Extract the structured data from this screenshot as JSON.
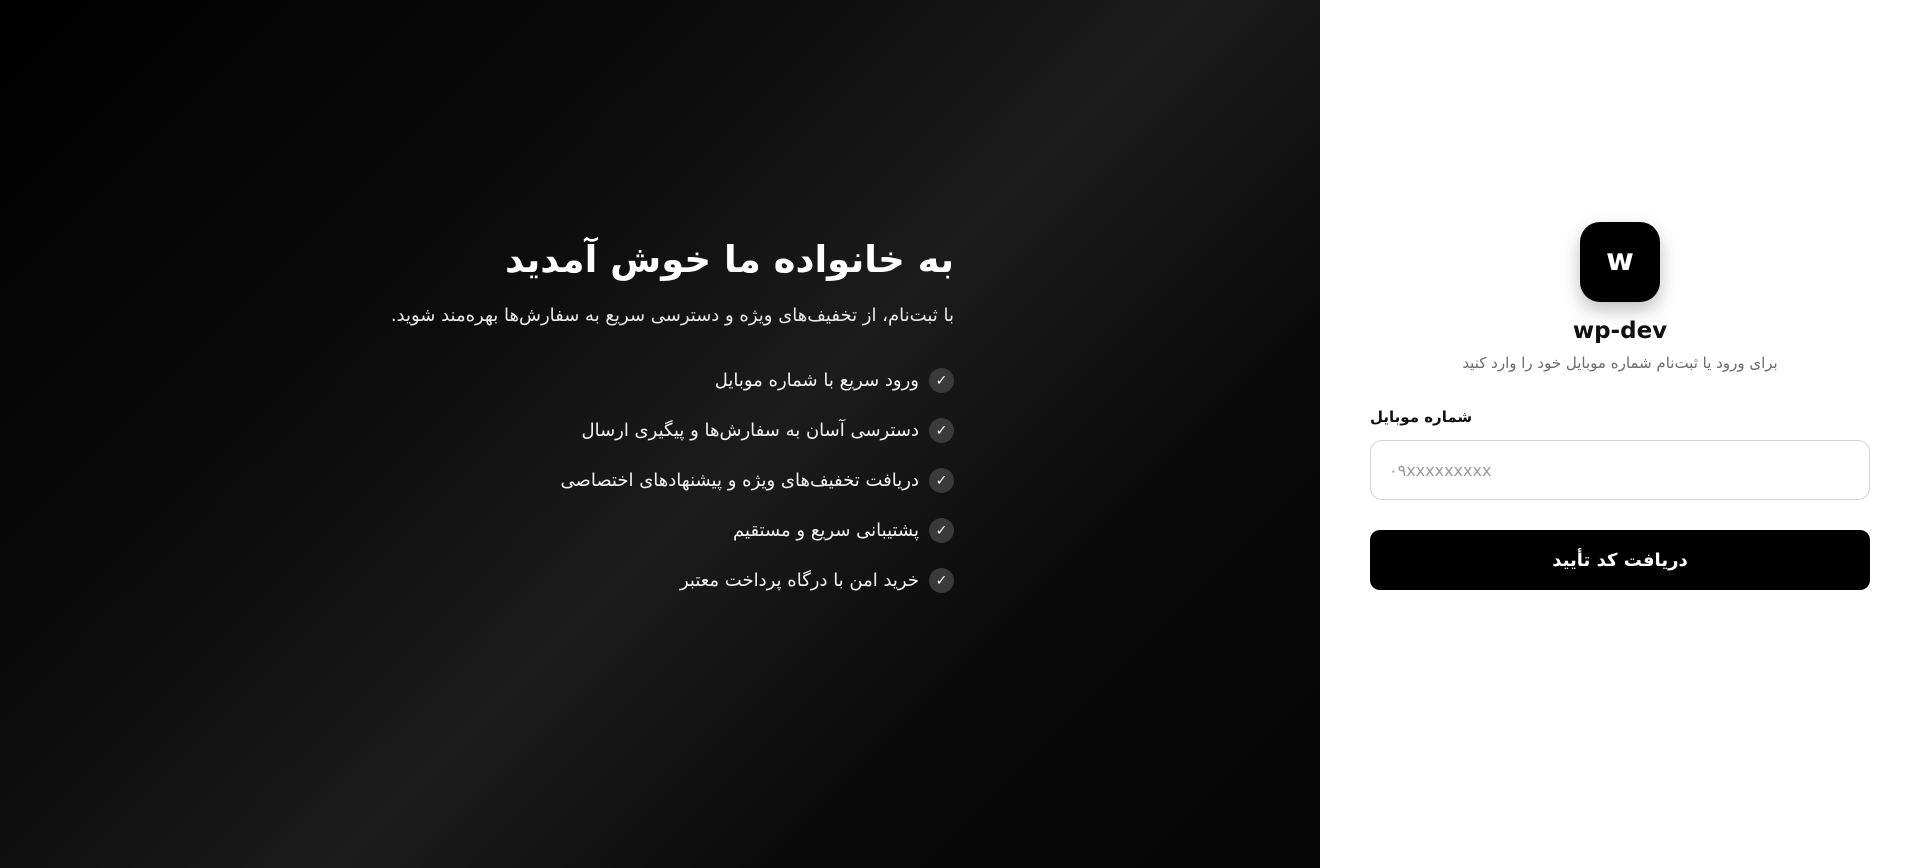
{
  "login": {
    "logo_letter": "w",
    "brand_name": "wp-dev",
    "subtitle": "برای ورود یا ثبت‌نام شماره موبایل خود را وارد کنید",
    "phone_label": "شماره موبایل",
    "phone_placeholder": "۰۹xxxxxxxxx",
    "phone_value": "",
    "submit_label": "دریافت کد تأیید"
  },
  "welcome": {
    "title": "به خانواده ما خوش آمدید",
    "subtitle": "با ثبت‌نام، از تخفیف‌های ویژه و دسترسی سریع به سفارش‌ها بهره‌مند شوید.",
    "features": [
      {
        "label": "ورود سریع با شماره موبایل",
        "icon": "check-icon"
      },
      {
        "label": "دسترسی آسان به سفارش‌ها و پیگیری ارسال",
        "icon": "check-icon"
      },
      {
        "label": "دریافت تخفیف‌های ویژه و پیشنهادهای اختصاصی",
        "icon": "check-icon"
      },
      {
        "label": "پشتیبانی سریع و مستقیم",
        "icon": "check-icon"
      },
      {
        "label": "خرید امن با درگاه پرداخت معتبر",
        "icon": "check-icon"
      }
    ]
  },
  "colors": {
    "accent": "#000000",
    "panel_dark": "#0c0c0c",
    "check_bg": "#3a3a3a"
  }
}
